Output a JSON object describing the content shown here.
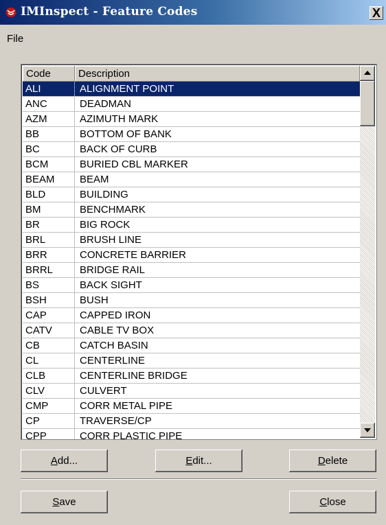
{
  "window": {
    "title": "IMInspect - Feature Codes",
    "close_glyph": "X"
  },
  "menu": {
    "file": "File"
  },
  "table": {
    "columns": {
      "code": "Code",
      "description": "Description"
    },
    "rows": [
      {
        "code": "ALI",
        "description": "ALIGNMENT POINT"
      },
      {
        "code": "ANC",
        "description": "DEADMAN"
      },
      {
        "code": "AZM",
        "description": "AZIMUTH MARK"
      },
      {
        "code": "BB",
        "description": "BOTTOM OF BANK"
      },
      {
        "code": "BC",
        "description": "BACK OF CURB"
      },
      {
        "code": "BCM",
        "description": "BURIED CBL MARKER"
      },
      {
        "code": "BEAM",
        "description": "BEAM"
      },
      {
        "code": "BLD",
        "description": "BUILDING"
      },
      {
        "code": "BM",
        "description": "BENCHMARK"
      },
      {
        "code": "BR",
        "description": "BIG ROCK"
      },
      {
        "code": "BRL",
        "description": "BRUSH LINE"
      },
      {
        "code": "BRR",
        "description": "CONCRETE BARRIER"
      },
      {
        "code": "BRRL",
        "description": "BRIDGE RAIL"
      },
      {
        "code": "BS",
        "description": "BACK SIGHT"
      },
      {
        "code": "BSH",
        "description": "BUSH"
      },
      {
        "code": "CAP",
        "description": "CAPPED IRON"
      },
      {
        "code": "CATV",
        "description": "CABLE TV BOX"
      },
      {
        "code": "CB",
        "description": "CATCH BASIN"
      },
      {
        "code": "CL",
        "description": "CENTERLINE"
      },
      {
        "code": "CLB",
        "description": "CENTERLINE BRIDGE"
      },
      {
        "code": "CLV",
        "description": "CULVERT"
      },
      {
        "code": "CMP",
        "description": "CORR METAL PIPE"
      },
      {
        "code": "CP",
        "description": "TRAVERSE/CP"
      },
      {
        "code": "CPP",
        "description": "CORR PLASTIC PIPE"
      }
    ],
    "selected_index": 0
  },
  "buttons": {
    "add": {
      "mnemonic": "A",
      "rest": "dd..."
    },
    "edit": {
      "mnemonic": "E",
      "rest": "dit..."
    },
    "delete": {
      "mnemonic": "D",
      "rest": "elete"
    },
    "save": {
      "mnemonic": "S",
      "rest": "ave"
    },
    "close": {
      "mnemonic": "C",
      "rest": "lose"
    }
  },
  "colors": {
    "selection": "#0a246a",
    "titlebar_start": "#0a246a",
    "face": "#d4d0c8"
  }
}
